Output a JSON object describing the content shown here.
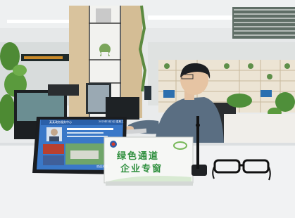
{
  "photo": {
    "description_label": "",
    "desk_sign": {
      "line1": "绿色通道",
      "line2": "企业专窗"
    },
    "tablet": {
      "header": "某某政务服务中心",
      "time": "2023年3月1日 星期三",
      "welcome": "欢迎光临"
    },
    "colors": {
      "sign_green": "#2f8f3e",
      "sign_bg": "#f4f6f3",
      "tablet_screen": "#3a78c8",
      "desk": "#f1f2f3",
      "shirt": "#5a6e82"
    }
  }
}
